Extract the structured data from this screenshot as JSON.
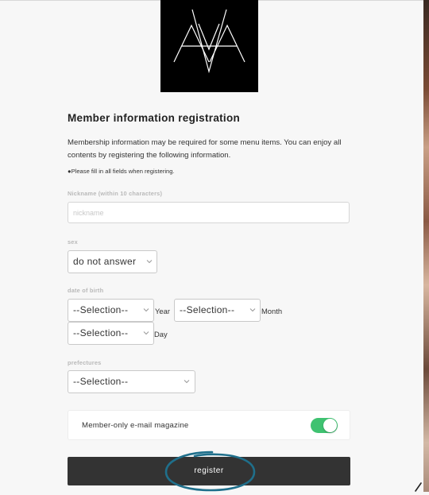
{
  "brand": {
    "logo_icon": "ava-monogram-logo"
  },
  "form": {
    "title": "Member information registration",
    "description": "Membership information may be required for some menu items. You can enjoy all contents by registering the following information.",
    "note": "●Please fill in all fields when registering.",
    "nickname": {
      "label": "Nickname (within 10 characters)",
      "placeholder": "nickname",
      "value": ""
    },
    "sex": {
      "label": "sex",
      "selected": "do not answer"
    },
    "dob": {
      "label": "date of birth",
      "year_selected": "--Selection--",
      "year_unit": "Year",
      "month_selected": "--Selection--",
      "month_unit": "Month",
      "day_selected": "--Selection--",
      "day_unit": "Day"
    },
    "prefecture": {
      "label": "prefectures",
      "selected": "--Selection--"
    },
    "newsletter": {
      "label": "Member-only e-mail magazine",
      "enabled": true
    },
    "submit_label": "register"
  },
  "colors": {
    "toggle_on": "#3fc271",
    "button_bg": "#333333",
    "annotation": "#1f6f8b"
  }
}
